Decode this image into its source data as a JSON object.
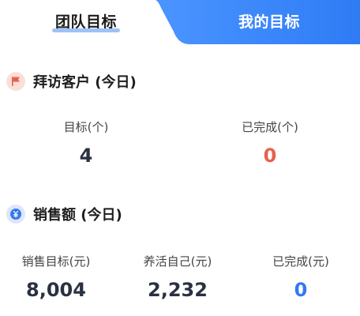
{
  "tabs": [
    {
      "label": "团队目标",
      "active": true
    },
    {
      "label": "我的目标",
      "active": false
    }
  ],
  "sections": {
    "visit": {
      "title": "拜访客户 (今日)",
      "icon": "flag-icon",
      "stats": [
        {
          "label": "目标(个)",
          "value": "4"
        },
        {
          "label": "已完成(个)",
          "value": "0"
        }
      ]
    },
    "sales": {
      "title": "销售额 (今日)",
      "icon": "yuan-coin-icon",
      "stats": [
        {
          "label": "销售目标(元)",
          "value": "8,004"
        },
        {
          "label": "养活自己(元)",
          "value": "2,232"
        },
        {
          "label": "已完成(元)",
          "value": "0"
        }
      ]
    }
  },
  "colors": {
    "accent_blue": "#2f7bf5",
    "tab_blue_light": "#4a95ff",
    "completed_red": "#e8604c",
    "completed_blue": "#3478f0",
    "value_dark": "#2a3140",
    "underline": "#9ec2f7"
  }
}
